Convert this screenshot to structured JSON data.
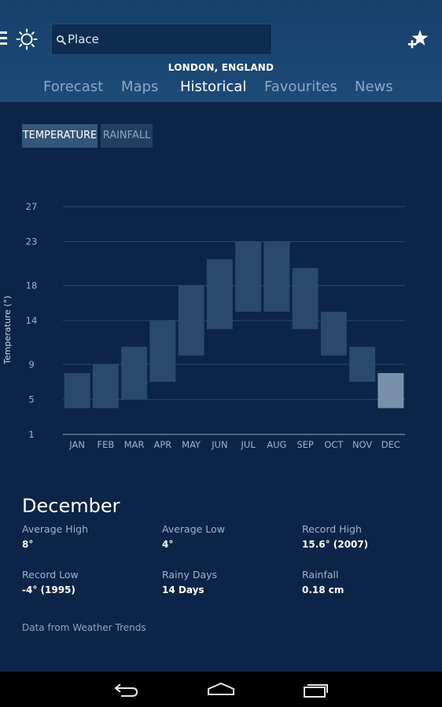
{
  "header": {
    "search": {
      "placeholder": "Place",
      "value": ""
    },
    "location": "LONDON, ENGLAND",
    "tabs": [
      {
        "label": "Forecast",
        "active": false
      },
      {
        "label": "Maps",
        "active": false
      },
      {
        "label": "Historical",
        "active": true
      },
      {
        "label": "Favourites",
        "active": false
      },
      {
        "label": "News",
        "active": false
      }
    ]
  },
  "toggles": [
    {
      "label": "TEMPERATURE",
      "active": true
    },
    {
      "label": "RAINFALL",
      "active": false
    }
  ],
  "chart_data": {
    "type": "bar",
    "subtype": "floating-range",
    "ylabel": "Temperature (°)",
    "yticks": [
      1,
      5,
      9,
      14,
      18,
      23,
      27
    ],
    "ylim": [
      1,
      27
    ],
    "grid": true,
    "categories": [
      "JAN",
      "FEB",
      "MAR",
      "APR",
      "MAY",
      "JUN",
      "JUL",
      "AUG",
      "SEP",
      "OCT",
      "NOV",
      "DEC"
    ],
    "low": [
      4,
      4,
      5,
      7,
      10,
      13,
      15,
      15,
      13,
      10,
      7,
      4
    ],
    "high": [
      8,
      9,
      11,
      14,
      18,
      21,
      23,
      23,
      20,
      15,
      11,
      8
    ],
    "selected": "DEC"
  },
  "details": {
    "month": "December",
    "stats": [
      {
        "label": "Average High",
        "value": "8°"
      },
      {
        "label": "Average Low",
        "value": "4°"
      },
      {
        "label": "Record High",
        "value": "15.6° (2007)"
      },
      {
        "label": "Record Low",
        "value": "-4° (1995)"
      },
      {
        "label": "Rainy Days",
        "value": "14 Days"
      },
      {
        "label": "Rainfall",
        "value": "0.18 cm"
      }
    ],
    "source": "Data from Weather Trends"
  },
  "colors": {
    "background": "#0b2447",
    "header": "#1a4573",
    "bar": "#2d4e6f",
    "bar_selected": "#7f97b0",
    "grid": "#2a4a6c"
  },
  "icons": [
    "menu-icon",
    "sun-icon",
    "search-icon",
    "add-favourite-icon",
    "back-icon",
    "home-icon",
    "recent-apps-icon"
  ]
}
